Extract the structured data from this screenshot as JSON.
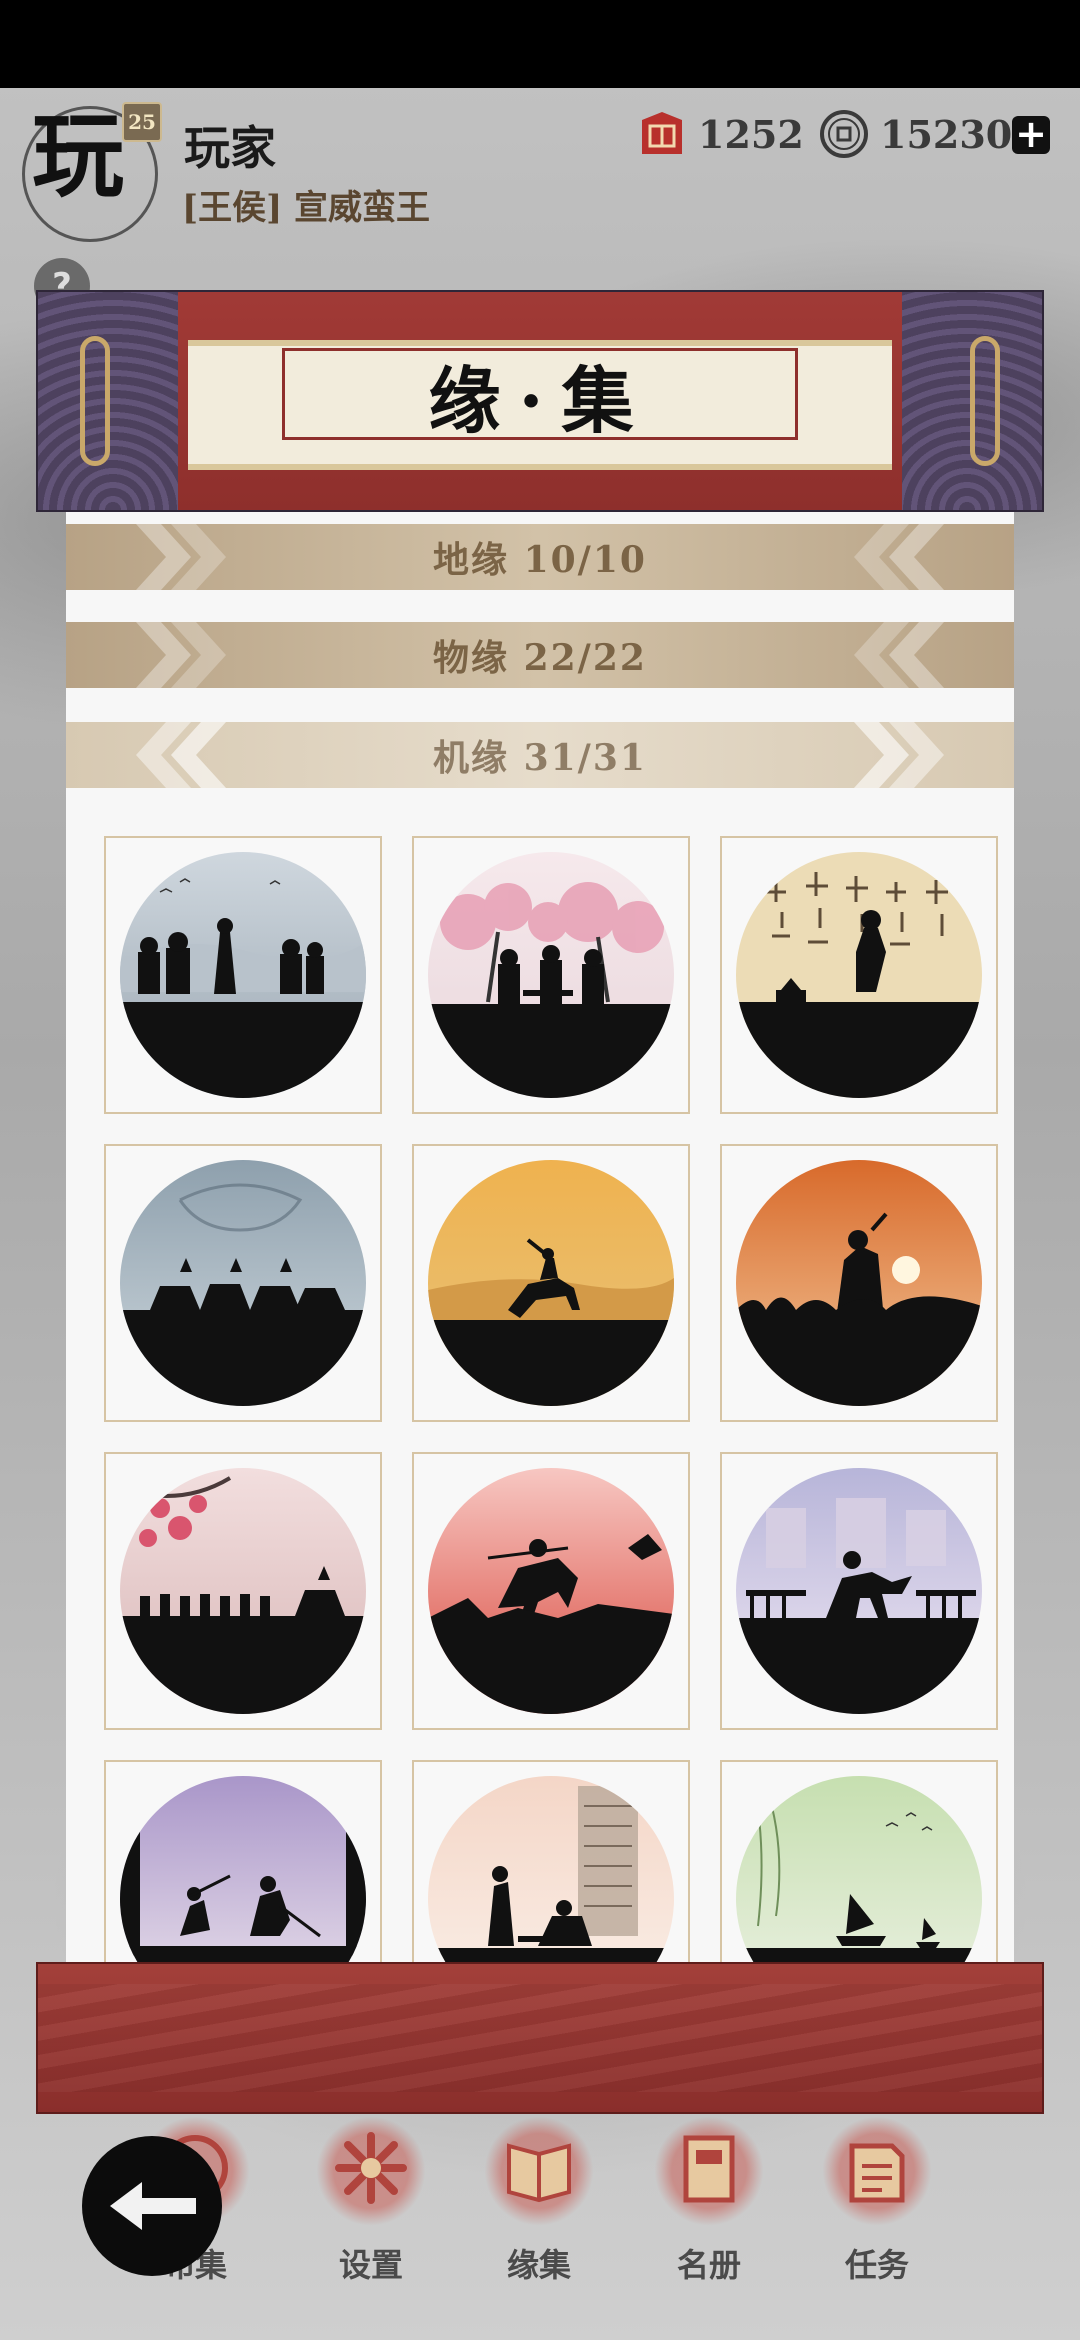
{
  "player": {
    "avatar_char": "玩",
    "level": "25",
    "name": "玩家",
    "title": "[王侯] 宣威蛮王"
  },
  "currencies": [
    {
      "icon": "red-seal-icon",
      "value": "1252"
    },
    {
      "icon": "coin-icon",
      "value": "15230"
    }
  ],
  "help_label": "?",
  "scroll": {
    "title": "缘·集"
  },
  "categories": [
    {
      "label": "地缘  10/10"
    },
    {
      "label": "物缘  22/22"
    },
    {
      "label": "机缘  31/31"
    }
  ],
  "cards": [
    {
      "name": "card-mist-warriors"
    },
    {
      "name": "card-peach-blossom-oath"
    },
    {
      "name": "card-calligraphy-strategist"
    },
    {
      "name": "card-tiger-cavalry"
    },
    {
      "name": "card-desert-rider"
    },
    {
      "name": "card-sunset-warrior"
    },
    {
      "name": "card-plum-blossom-army"
    },
    {
      "name": "card-red-sky-horseman"
    },
    {
      "name": "card-palace-fighter"
    },
    {
      "name": "card-purple-duel"
    },
    {
      "name": "card-scroll-scene"
    },
    {
      "name": "card-green-river-boat"
    }
  ],
  "nav": [
    {
      "label": "布集",
      "icon": "collection-icon"
    },
    {
      "label": "设置",
      "icon": "settings-icon"
    },
    {
      "label": "缘集",
      "icon": "book-icon"
    },
    {
      "label": "名册",
      "icon": "roster-icon"
    },
    {
      "label": "任务",
      "icon": "task-icon"
    }
  ],
  "back_icon": "back-arrow-icon"
}
